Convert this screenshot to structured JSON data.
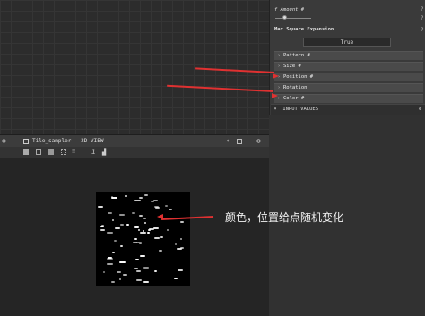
{
  "properties": {
    "amount_label": "f Amount #",
    "max_square_expansion_label": "Max Square Expansion",
    "max_square_expansion_value": "True",
    "help_icon": "?",
    "sections": [
      {
        "label": "Pattern #"
      },
      {
        "label": "Size #"
      },
      {
        "label": "Position #"
      },
      {
        "label": "Rotation"
      },
      {
        "label": "Color #"
      }
    ],
    "input_values_label": "INPUT VALUES"
  },
  "viewer": {
    "title": "Tile_sampler - 2D VIEW",
    "info_icon": "i"
  },
  "annotation": {
    "text": "颜色，位置给点随机变化"
  },
  "icons": {
    "chevron": "chevron-right-icon",
    "gear": "gear-icon",
    "pin": "pin-icon",
    "close": "close-icon",
    "histogram": "histogram-icon"
  },
  "colors": {
    "accent_arrow": "#e03131",
    "panel_bg": "#3a3a3a",
    "section_bg": "#4a4a4a"
  }
}
